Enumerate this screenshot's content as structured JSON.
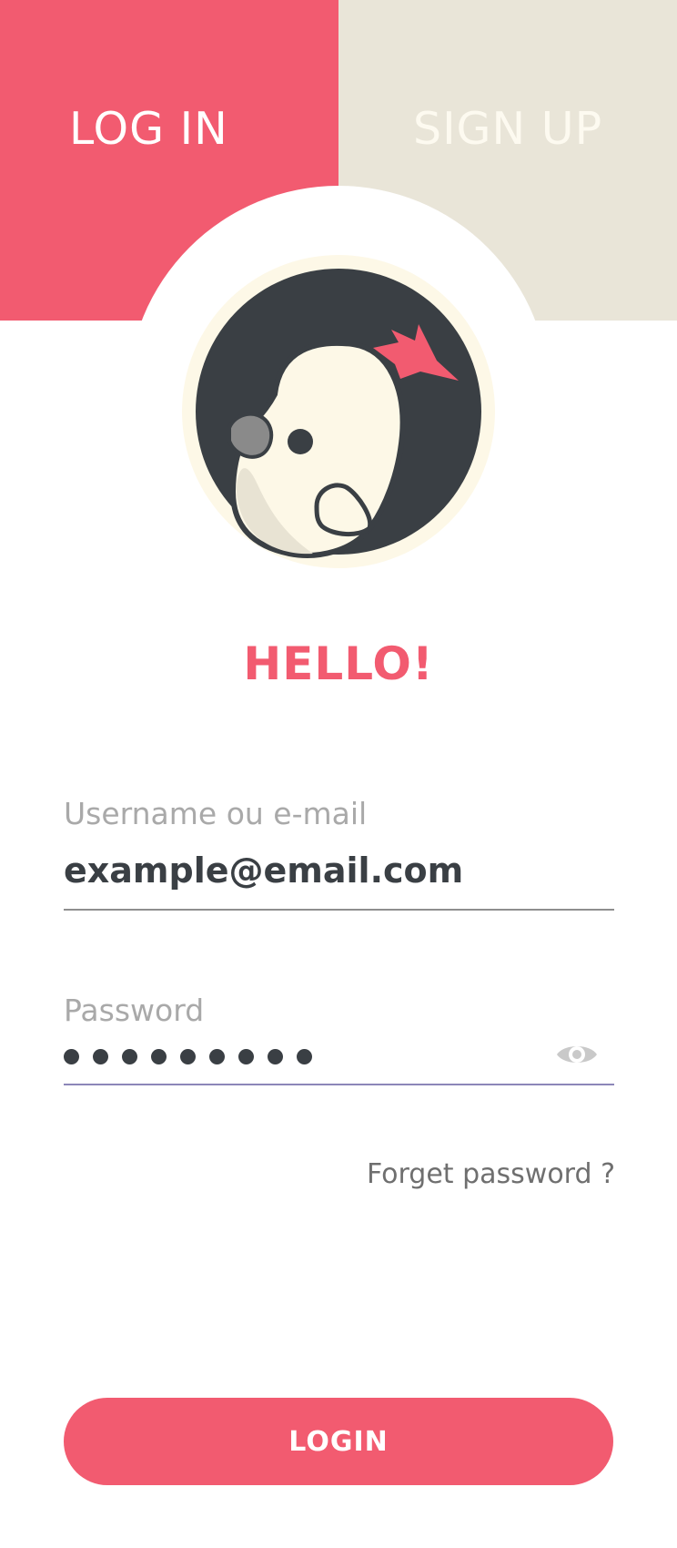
{
  "tabs": {
    "login": "LOG IN",
    "signup": "SIGN UP"
  },
  "greeting": "HELLO!",
  "username_field": {
    "label": "Username ou e-mail",
    "value": "example@email.com"
  },
  "password_field": {
    "label": "Password",
    "masked_length": 9,
    "toggle_icon": "eye-icon"
  },
  "forgot_link": "Forget password ?",
  "login_button": "LOGIN",
  "colors": {
    "accent": "#f25b70",
    "secondary_tab": "#e9e5d8",
    "text_dark": "#3a3f44",
    "label_gray": "#a9a9a9",
    "active_underline": "#8c86b8"
  }
}
